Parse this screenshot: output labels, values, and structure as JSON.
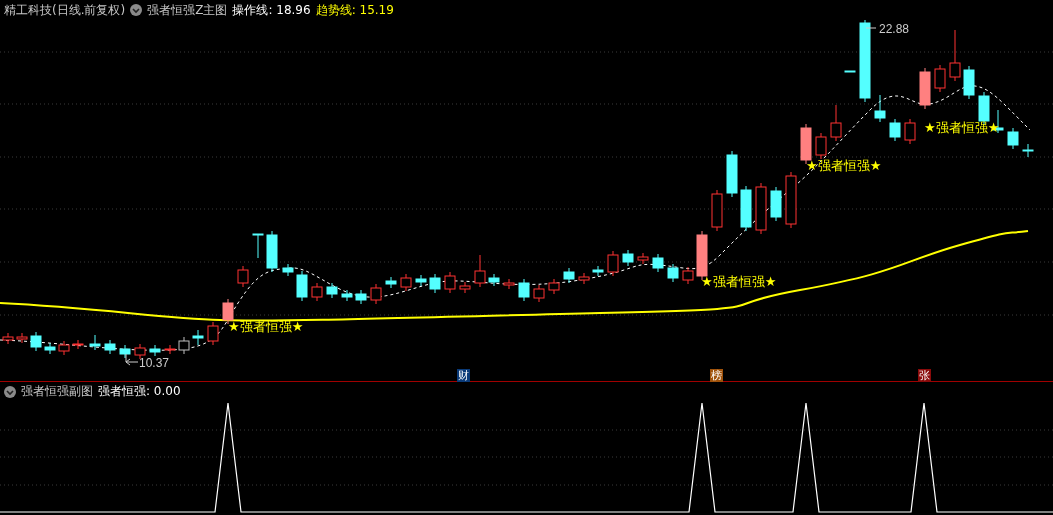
{
  "header": {
    "title": "精工科技(日线.前复权)",
    "indicator": "强者恒强Z主图",
    "lines": [
      {
        "label": "操作线:",
        "value": "18.96",
        "color": "#ffffff"
      },
      {
        "label": "趋势线:",
        "value": "15.19",
        "color": "#ffff00"
      }
    ]
  },
  "main_chart": {
    "signal_labels": [
      "★强者恒强★",
      "★强者恒强★",
      "★强者恒强★",
      "★强者恒强★"
    ],
    "high_marker": "22.88",
    "low_marker": "10.37",
    "badges": [
      {
        "text": "财",
        "color": "#0a3a78"
      },
      {
        "text": "榜",
        "color": "#a0520a"
      },
      {
        "text": "张",
        "color": "#8a0a0a"
      }
    ]
  },
  "sub_chart": {
    "indicator": "强者恒强副图",
    "line": {
      "label": "强者恒强:",
      "value": "0.00"
    }
  }
}
